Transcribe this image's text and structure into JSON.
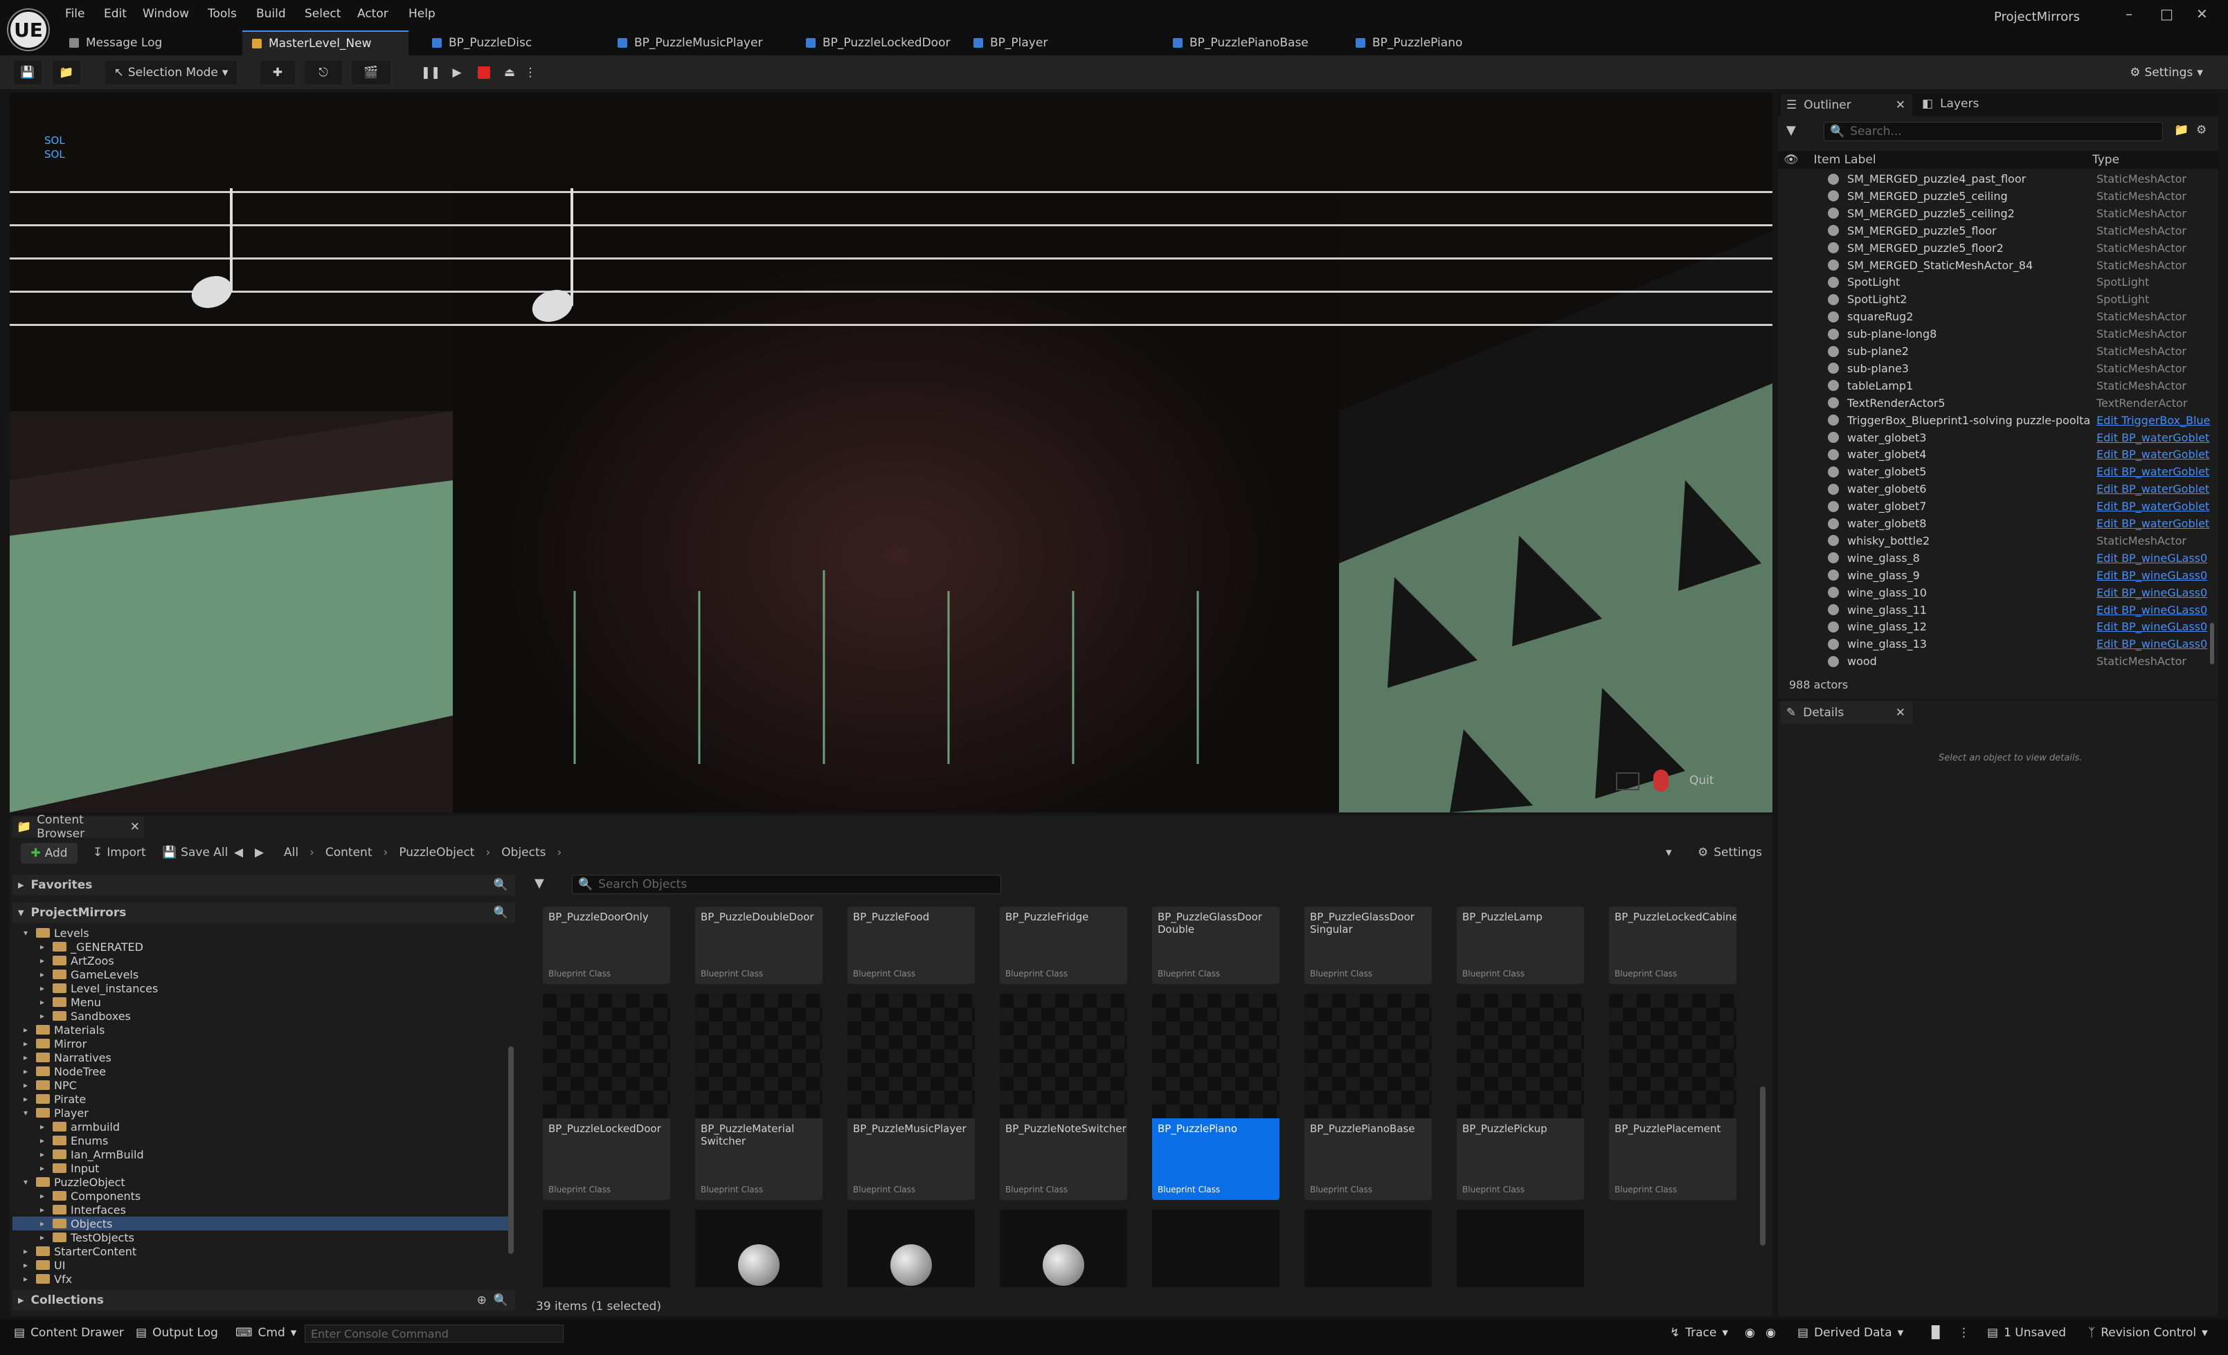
{
  "app": {
    "project_name": "ProjectMirrors",
    "logo": "UE"
  },
  "menu": [
    "File",
    "Edit",
    "Window",
    "Tools",
    "Build",
    "Select",
    "Actor",
    "Help"
  ],
  "tabs": [
    {
      "label": "Message Log",
      "icon": "log-icon"
    },
    {
      "label": "MasterLevel_New",
      "icon": "level-icon",
      "active": true
    },
    {
      "label": "BP_PuzzleDisc",
      "icon": "blueprint-icon"
    },
    {
      "label": "BP_PuzzleMusicPlayer",
      "icon": "blueprint-icon"
    },
    {
      "label": "BP_PuzzleLockedDoor",
      "icon": "blueprint-icon"
    },
    {
      "label": "BP_Player",
      "icon": "blueprint-icon"
    },
    {
      "label": "BP_PuzzlePianoBase",
      "icon": "blueprint-icon"
    },
    {
      "label": "BP_PuzzlePiano",
      "icon": "blueprint-icon"
    }
  ],
  "toolbar": {
    "mode_label": "Selection Mode",
    "settings_label": "Settings"
  },
  "viewport": {
    "note_labels": [
      "SOL",
      "SOL"
    ],
    "quit_label": "Quit"
  },
  "outliner": {
    "tab_label": "Outliner",
    "layers_label": "Layers",
    "search_placeholder": "Search...",
    "col_label": "Item Label",
    "col_type": "Type",
    "rows": [
      {
        "label": "SM_MERGED_puzzle4_past_floor",
        "type": "StaticMeshActor"
      },
      {
        "label": "SM_MERGED_puzzle5_ceiling",
        "type": "StaticMeshActor"
      },
      {
        "label": "SM_MERGED_puzzle5_ceiling2",
        "type": "StaticMeshActor"
      },
      {
        "label": "SM_MERGED_puzzle5_floor",
        "type": "StaticMeshActor"
      },
      {
        "label": "SM_MERGED_puzzle5_floor2",
        "type": "StaticMeshActor"
      },
      {
        "label": "SM_MERGED_StaticMeshActor_84",
        "type": "StaticMeshActor"
      },
      {
        "label": "SpotLight",
        "type": "SpotLight"
      },
      {
        "label": "SpotLight2",
        "type": "SpotLight"
      },
      {
        "label": "squareRug2",
        "type": "StaticMeshActor"
      },
      {
        "label": "sub-plane-long8",
        "type": "StaticMeshActor"
      },
      {
        "label": "sub-plane2",
        "type": "StaticMeshActor"
      },
      {
        "label": "sub-plane3",
        "type": "StaticMeshActor"
      },
      {
        "label": "tableLamp1",
        "type": "StaticMeshActor"
      },
      {
        "label": "TextRenderActor5",
        "type": "TextRenderActor"
      },
      {
        "label": "TriggerBox_Blueprint1-solving puzzle-poolta",
        "type": "Edit TriggerBox_Blue",
        "link": true
      },
      {
        "label": "water_globet3",
        "type": "Edit BP_waterGoblet",
        "link": true
      },
      {
        "label": "water_globet4",
        "type": "Edit BP_waterGoblet",
        "link": true
      },
      {
        "label": "water_globet5",
        "type": "Edit BP_waterGoblet",
        "link": true
      },
      {
        "label": "water_globet6",
        "type": "Edit BP_waterGoblet",
        "link": true
      },
      {
        "label": "water_globet7",
        "type": "Edit BP_waterGoblet",
        "link": true
      },
      {
        "label": "water_globet8",
        "type": "Edit BP_waterGoblet",
        "link": true
      },
      {
        "label": "whisky_bottle2",
        "type": "StaticMeshActor"
      },
      {
        "label": "wine_glass_8",
        "type": "Edit BP_wineGLass0",
        "link": true
      },
      {
        "label": "wine_glass_9",
        "type": "Edit BP_wineGLass0",
        "link": true
      },
      {
        "label": "wine_glass_10",
        "type": "Edit BP_wineGLass0",
        "link": true
      },
      {
        "label": "wine_glass_11",
        "type": "Edit BP_wineGLass0",
        "link": true
      },
      {
        "label": "wine_glass_12",
        "type": "Edit BP_wineGLass0",
        "link": true
      },
      {
        "label": "wine_glass_13",
        "type": "Edit BP_wineGLass0",
        "link": true
      },
      {
        "label": "wood",
        "type": "StaticMeshActor"
      }
    ],
    "actor_count": "988 actors"
  },
  "details": {
    "tab_label": "Details",
    "hint": "Select an object to view details."
  },
  "content_browser": {
    "tab_label": "Content Browser",
    "add_label": "Add",
    "import_label": "Import",
    "saveall_label": "Save All",
    "breadcrumb": [
      "All",
      "Content",
      "PuzzleObject",
      "Objects"
    ],
    "settings_label": "Settings",
    "favorites_label": "Favorites",
    "project_label": "ProjectMirrors",
    "search_placeholder": "Search Objects",
    "collections_label": "Collections",
    "tree": [
      {
        "label": "Levels",
        "depth": 1,
        "expanded": true
      },
      {
        "label": "_GENERATED",
        "depth": 2
      },
      {
        "label": "ArtZoos",
        "depth": 2
      },
      {
        "label": "GameLevels",
        "depth": 2
      },
      {
        "label": "Level_instances",
        "depth": 2
      },
      {
        "label": "Menu",
        "depth": 2
      },
      {
        "label": "Sandboxes",
        "depth": 2
      },
      {
        "label": "Materials",
        "depth": 1
      },
      {
        "label": "Mirror",
        "depth": 1
      },
      {
        "label": "Narratives",
        "depth": 1
      },
      {
        "label": "NodeTree",
        "depth": 1
      },
      {
        "label": "NPC",
        "depth": 1
      },
      {
        "label": "Pirate",
        "depth": 1
      },
      {
        "label": "Player",
        "depth": 1,
        "expanded": true
      },
      {
        "label": "armbuild",
        "depth": 2
      },
      {
        "label": "Enums",
        "depth": 2
      },
      {
        "label": "Ian_ArmBuild",
        "depth": 2
      },
      {
        "label": "Input",
        "depth": 2
      },
      {
        "label": "PuzzleObject",
        "depth": 1,
        "expanded": true
      },
      {
        "label": "Components",
        "depth": 2
      },
      {
        "label": "Interfaces",
        "depth": 2
      },
      {
        "label": "Objects",
        "depth": 2,
        "selected": true
      },
      {
        "label": "TestObjects",
        "depth": 2
      },
      {
        "label": "StarterContent",
        "depth": 1
      },
      {
        "label": "UI",
        "depth": 1
      },
      {
        "label": "Vfx",
        "depth": 1
      }
    ],
    "assets_row1": [
      "BP_PuzzleDoorOnly",
      "BP_PuzzleDoubleDoor",
      "BP_PuzzleFood",
      "BP_PuzzleFridge",
      "BP_PuzzleGlassDoor Double",
      "BP_PuzzleGlassDoor Singular",
      "BP_PuzzleLamp",
      "BP_PuzzleLockedCabinet"
    ],
    "assets_row2": [
      "BP_PuzzleLockedDoor",
      "BP_PuzzleMaterial Switcher",
      "BP_PuzzleMusicPlayer",
      "BP_PuzzleNoteSwitcher",
      "BP_PuzzlePiano",
      "BP_PuzzlePianoBase",
      "BP_PuzzlePickup",
      "BP_PuzzlePlacement"
    ],
    "asset_class": "Blueprint Class",
    "selected_asset": "BP_PuzzlePiano",
    "items_status": "39 items (1 selected)"
  },
  "statusbar": {
    "content_drawer": "Content Drawer",
    "output_log": "Output Log",
    "cmd": "Cmd",
    "console_placeholder": "Enter Console Command",
    "trace": "Trace",
    "derived_data": "Derived Data",
    "unsaved": "1 Unsaved",
    "revision": "Revision Control"
  }
}
